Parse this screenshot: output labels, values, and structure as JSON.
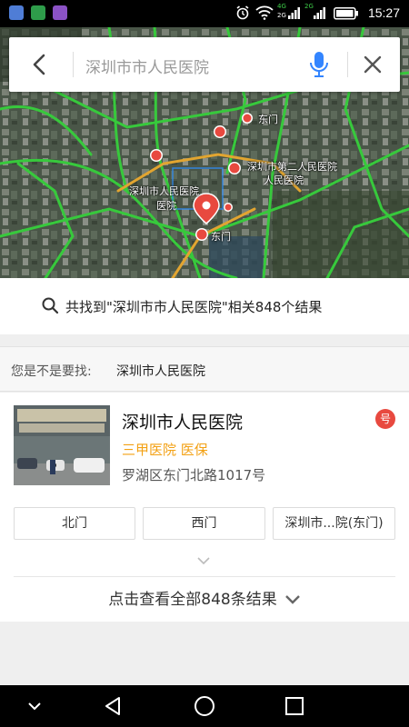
{
  "status_bar": {
    "time": "15:27",
    "network_top": "4G",
    "network_bottom": "2G",
    "network2_top": "2G"
  },
  "map": {
    "labels": [
      "深圳市人民医院",
      "深圳市第二人民医院",
      "东门",
      "东门",
      "医院",
      "人民医院"
    ]
  },
  "search": {
    "query": "深圳市市人民医院",
    "back_icon": "back-arrow-icon",
    "mic_icon": "microphone-icon",
    "close_icon": "close-icon",
    "accent": "#3385ff"
  },
  "summary": {
    "text": "共找到\"深圳市市人民医院\"相关848个结果"
  },
  "suggestion": {
    "prefix": "您是不是要找:",
    "keyword": "深圳市人民医院"
  },
  "result": {
    "title": "深圳市人民医院",
    "tags": "三甲医院 医保",
    "address": "罗湖区东门北路1017号",
    "badge": "号",
    "badge_color": "#e8493f",
    "tag_color": "#f3a114",
    "sub_pois": [
      "北门",
      "西门",
      "深圳市...院(东门)"
    ],
    "view_all": "点击查看全部848条结果"
  }
}
